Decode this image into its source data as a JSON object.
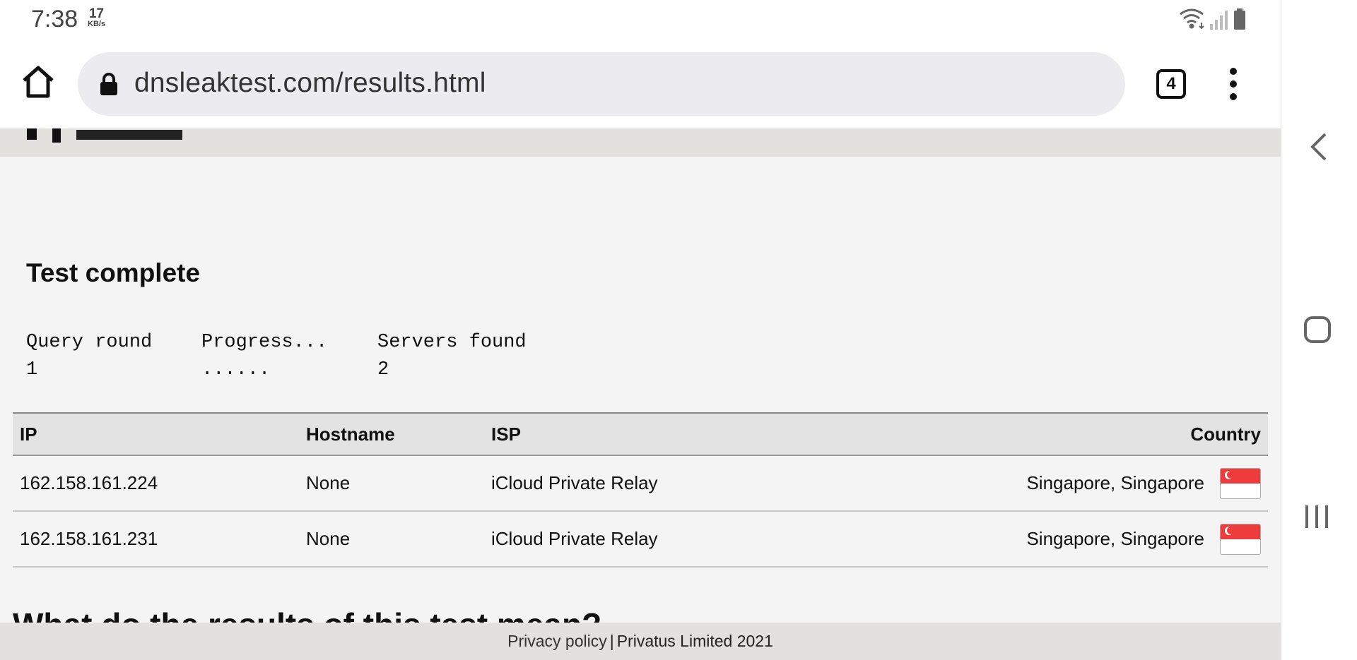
{
  "status_bar": {
    "time": "7:38",
    "speed_value": "17",
    "speed_unit": "KB/s",
    "icons": [
      "wifi-icon",
      "signal-icon",
      "battery-icon"
    ]
  },
  "browser": {
    "url": "dnsleaktest.com/results.html",
    "tab_count": "4",
    "icons": [
      "home-icon",
      "lock-icon",
      "tabs-icon",
      "more-menu-icon"
    ]
  },
  "page": {
    "title": "Test complete",
    "stats": [
      {
        "label": "Query round",
        "value": "1"
      },
      {
        "label": "Progress...",
        "value": "......"
      },
      {
        "label": "Servers found",
        "value": "2"
      }
    ],
    "table": {
      "headers": {
        "ip": "IP",
        "hostname": "Hostname",
        "isp": "ISP",
        "country": "Country"
      },
      "rows": [
        {
          "ip": "162.158.161.224",
          "hostname": "None",
          "isp": "iCloud Private Relay",
          "country": "Singapore, Singapore",
          "flag": "singapore-flag-icon"
        },
        {
          "ip": "162.158.161.231",
          "hostname": "None",
          "isp": "iCloud Private Relay",
          "country": "Singapore, Singapore",
          "flag": "singapore-flag-icon"
        }
      ]
    },
    "next_heading": "What do the results of this test mean?"
  },
  "footer": {
    "privacy_link": "Privacy policy",
    "separator": "|",
    "company": "Privatus Limited 2021"
  },
  "colors": {
    "page_bg": "#f4f4f5",
    "header_band": "#e3e1dd",
    "table_header_bg": "#e3e3e3",
    "footer_bg": "#e2e1e0",
    "url_bar_bg": "#ececf0",
    "flag_red": "#ee3b3b"
  }
}
